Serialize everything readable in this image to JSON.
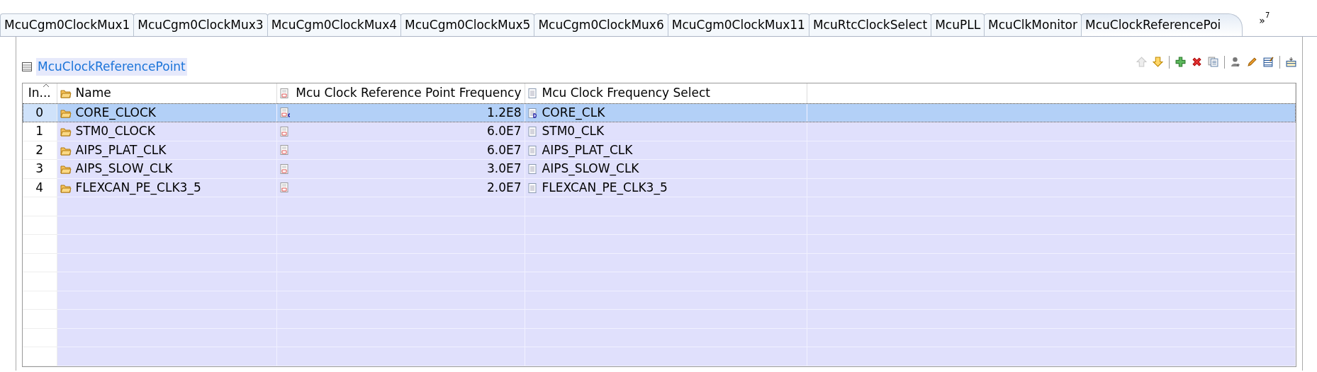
{
  "tabs": [
    {
      "label": "McuCgm0ClockMux1",
      "selected": false
    },
    {
      "label": "McuCgm0ClockMux3",
      "selected": false
    },
    {
      "label": "McuCgm0ClockMux4",
      "selected": false
    },
    {
      "label": "McuCgm0ClockMux5",
      "selected": false
    },
    {
      "label": "McuCgm0ClockMux6",
      "selected": false
    },
    {
      "label": "McuCgm0ClockMux11",
      "selected": false
    },
    {
      "label": "McuRtcClockSelect",
      "selected": false
    },
    {
      "label": "McuPLL",
      "selected": false
    },
    {
      "label": "McuClkMonitor",
      "selected": false
    },
    {
      "label": "McuClockReferencePoi",
      "selected": true
    }
  ],
  "tab_overflow": {
    "symbol": "»",
    "count": "7"
  },
  "section_title": "McuClockReferencePoint",
  "toolbar": [
    {
      "kind": "up",
      "disabled": true
    },
    {
      "kind": "down",
      "disabled": false
    },
    {
      "kind": "sep"
    },
    {
      "kind": "add",
      "disabled": false
    },
    {
      "kind": "delete",
      "disabled": false
    },
    {
      "kind": "copy",
      "disabled": false
    },
    {
      "kind": "sep"
    },
    {
      "kind": "user",
      "disabled": false
    },
    {
      "kind": "edit",
      "disabled": false
    },
    {
      "kind": "table-edit",
      "disabled": false
    },
    {
      "kind": "sep"
    },
    {
      "kind": "insert",
      "disabled": false
    }
  ],
  "table": {
    "columns": [
      "In...",
      "Name",
      "Mcu Clock Reference Point Frequency",
      "Mcu Clock Frequency Select"
    ],
    "rows": [
      {
        "index": "0",
        "name": "CORE_CLOCK",
        "frequency": "1.2E8",
        "select": "CORE_CLK",
        "selected": true,
        "calculated": true
      },
      {
        "index": "1",
        "name": "STM0_CLOCK",
        "frequency": "6.0E7",
        "select": "STM0_CLK",
        "selected": false,
        "calculated": false
      },
      {
        "index": "2",
        "name": "AIPS_PLAT_CLK",
        "frequency": "6.0E7",
        "select": "AIPS_PLAT_CLK",
        "selected": false,
        "calculated": false
      },
      {
        "index": "3",
        "name": "AIPS_SLOW_CLK",
        "frequency": "3.0E7",
        "select": "AIPS_SLOW_CLK",
        "selected": false,
        "calculated": false
      },
      {
        "index": "4",
        "name": "FLEXCAN_PE_CLK3_5",
        "frequency": "2.0E7",
        "select": "FLEXCAN_PE_CLK3_5",
        "selected": false,
        "calculated": false
      }
    ]
  }
}
